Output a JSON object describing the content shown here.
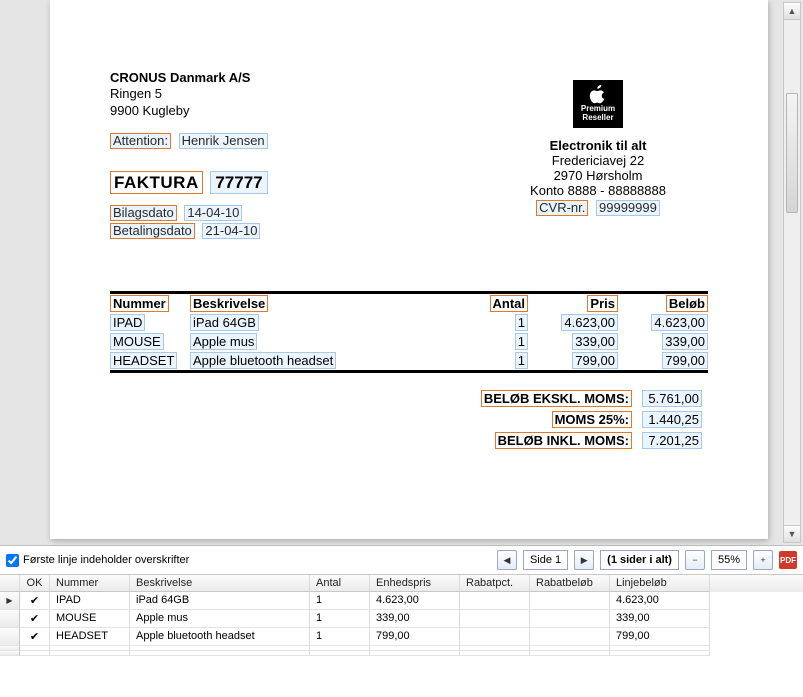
{
  "sender": {
    "company": "CRONUS Danmark A/S",
    "addr1": "Ringen 5",
    "addr2": "9900 Kugleby",
    "attention_label": "Attention:",
    "attention_value": "Henrik Jensen"
  },
  "invoice": {
    "title": "FAKTURA",
    "number": "77777",
    "date_label1": "Bilagsdato",
    "date_value1": "14-04-10",
    "date_label2": "Betalingsdato",
    "date_value2": "21-04-10"
  },
  "reseller": {
    "logo_line1": "Premium",
    "logo_line2": "Reseller",
    "name": "Electronik til alt",
    "addr1": "Fredericiavej 22",
    "addr2": "2970  Hørsholm",
    "account": "Konto 8888 - 88888888",
    "cvr_label": "CVR-nr.",
    "cvr_value": "99999999"
  },
  "line_headers": {
    "num": "Nummer",
    "desc": "Beskrivelse",
    "qty": "Antal",
    "price": "Pris",
    "amount": "Beløb"
  },
  "lines": [
    {
      "num": "IPAD",
      "desc": "iPad 64GB",
      "qty": "1",
      "price": "4.623,00",
      "amount": "4.623,00"
    },
    {
      "num": "MOUSE",
      "desc": "Apple mus",
      "qty": "1",
      "price": "339,00",
      "amount": "339,00"
    },
    {
      "num": "HEADSET",
      "desc": "Apple bluetooth headset",
      "qty": "1",
      "price": "799,00",
      "amount": "799,00"
    }
  ],
  "totals": {
    "ex_label": "BELØB EKSKL. MOMS:",
    "ex_value": "5.761,00",
    "vat_label": "MOMS 25%:",
    "vat_value": "1.440,25",
    "inc_label": "BELØB INKL. MOMS:",
    "inc_value": "7.201,25"
  },
  "toolbar": {
    "first_line_header": "Første linje indeholder overskrifter",
    "page_label": "Side",
    "page_value": "1",
    "page_count": "(1 sider i alt)",
    "zoom": "55%"
  },
  "grid": {
    "headers": {
      "ok": "OK",
      "num": "Nummer",
      "desc": "Beskrivelse",
      "qty": "Antal",
      "unitprice": "Enhedspris",
      "rabatpct": "Rabatpct.",
      "rabatbel": "Rabatbeløb",
      "linebel": "Linjebeløb"
    },
    "rows": [
      {
        "ok": true,
        "num": "IPAD",
        "desc": "iPad 64GB",
        "qty": "1",
        "unitprice": "4.623,00",
        "rabatpct": "",
        "rabatbel": "",
        "linebel": "4.623,00",
        "active": true
      },
      {
        "ok": true,
        "num": "MOUSE",
        "desc": "Apple mus",
        "qty": "1",
        "unitprice": "339,00",
        "rabatpct": "",
        "rabatbel": "",
        "linebel": "339,00",
        "active": false
      },
      {
        "ok": true,
        "num": "HEADSET",
        "desc": "Apple bluetooth headset",
        "qty": "1",
        "unitprice": "799,00",
        "rabatpct": "",
        "rabatbel": "",
        "linebel": "799,00",
        "active": false
      }
    ]
  }
}
